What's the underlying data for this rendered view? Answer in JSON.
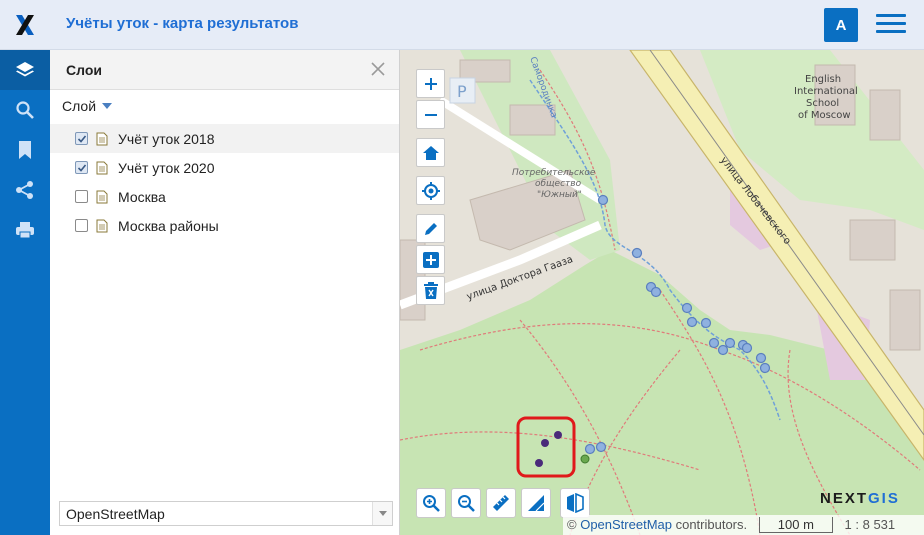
{
  "header": {
    "title": "Учёты уток - карта результатов",
    "avatar_letter": "A"
  },
  "sidebar": {
    "items": [
      "layers-icon",
      "search-icon",
      "bookmark-icon",
      "share-icon",
      "print-icon"
    ]
  },
  "panel": {
    "title": "Слои",
    "layer_dropdown": "Слой",
    "layers": [
      {
        "label": "Учёт уток 2018",
        "checked": true
      },
      {
        "label": "Учёт уток 2020",
        "checked": true
      },
      {
        "label": "Москва",
        "checked": false
      },
      {
        "label": "Москва районы",
        "checked": false
      }
    ],
    "basemap": "OpenStreetMap"
  },
  "map": {
    "labels": {
      "school": [
        "English",
        "International",
        "School",
        "of Moscow"
      ],
      "shop": [
        "Потребительское",
        "общество",
        "\"Южный\""
      ],
      "street1": "улица Лобачевского",
      "street2": "улица Доктора Гааза",
      "parking": "P",
      "river": "Самородинка"
    },
    "attribution_prefix": "© ",
    "attribution_link": "OpenStreetMap",
    "attribution_suffix": " contributors.",
    "scale": "100 m",
    "ratio": "1 : 8 531",
    "brand_a": "NEXT",
    "brand_b": "GIS",
    "colors": {
      "park": "#c8e6b4",
      "urban": "#e8e3d8",
      "road": "#f7f2c8",
      "point_2018": "#4a2a7a",
      "point_2020": "#8fb1df",
      "highlight": "#e0191b"
    }
  }
}
